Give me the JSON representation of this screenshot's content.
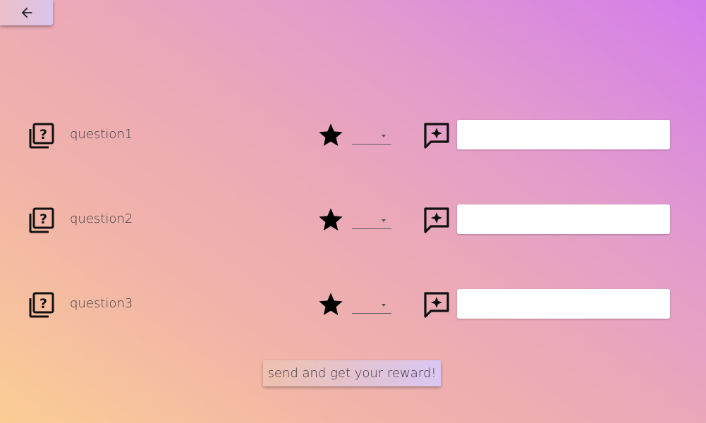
{
  "header": {
    "back_icon": "arrow-left-icon"
  },
  "questions": [
    {
      "label": "question1",
      "rating_value": "",
      "comment_value": "",
      "comment_placeholder": ""
    },
    {
      "label": "question2",
      "rating_value": "",
      "comment_value": "",
      "comment_placeholder": ""
    },
    {
      "label": "question3",
      "rating_value": "",
      "comment_value": "",
      "comment_placeholder": ""
    }
  ],
  "icons": {
    "question": "quiz-icon",
    "rating": "star-icon",
    "comment": "rate-review-icon"
  },
  "submit": {
    "label": "send and get your reward!"
  },
  "colors": {
    "gradient_start": "#fbcd94",
    "gradient_mid": "#eaa8b8",
    "gradient_end": "#d47ceb",
    "text": "#3a3540"
  }
}
